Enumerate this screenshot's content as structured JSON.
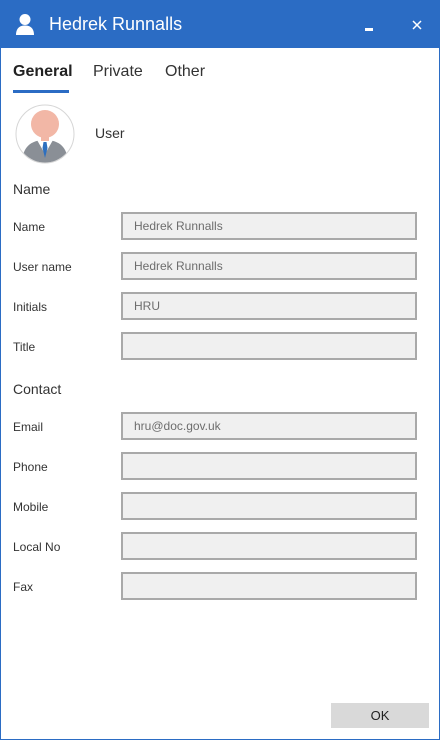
{
  "window": {
    "title": "Hedrek Runnalls",
    "accent_color": "#2b6cc4",
    "icons": {
      "app": "user-icon",
      "minimize": "minimize-icon",
      "close": "close-icon"
    }
  },
  "tabs": [
    {
      "label": "General",
      "active": true
    },
    {
      "label": "Private",
      "active": false
    },
    {
      "label": "Other",
      "active": false
    }
  ],
  "profile": {
    "avatar": "user-avatar-icon",
    "type_label": "User"
  },
  "sections": {
    "name": {
      "heading": "Name",
      "fields": [
        {
          "label": "Name",
          "value": "Hedrek Runnalls"
        },
        {
          "label": "User name",
          "value": "Hedrek Runnalls"
        },
        {
          "label": "Initials",
          "value": "HRU"
        },
        {
          "label": "Title",
          "value": ""
        }
      ]
    },
    "contact": {
      "heading": "Contact",
      "fields": [
        {
          "label": "Email",
          "value": "hru@doc.gov.uk"
        },
        {
          "label": "Phone",
          "value": ""
        },
        {
          "label": "Mobile",
          "value": ""
        },
        {
          "label": "Local No",
          "value": ""
        },
        {
          "label": "Fax",
          "value": ""
        }
      ]
    }
  },
  "footer": {
    "ok_label": "OK"
  }
}
